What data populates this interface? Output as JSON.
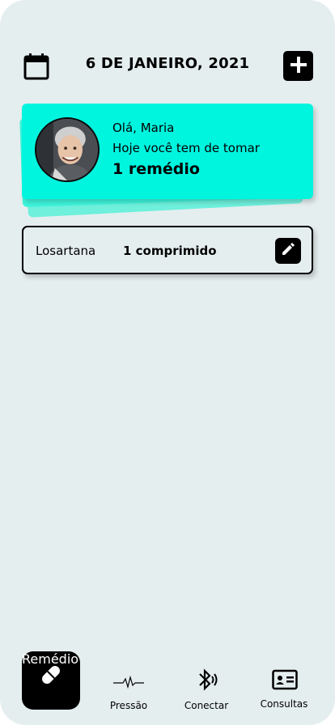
{
  "header": {
    "date": "6 DE JANEIRO, 2021",
    "calendar_icon": "calendar-icon",
    "add_icon": "plus-icon"
  },
  "summary": {
    "greeting": "Olá, Maria",
    "subtitle": "Hoje você tem de tomar",
    "count": "1 remédio",
    "accent_color": "#00f5df"
  },
  "medications": [
    {
      "name": "Losartana",
      "dose": "1 comprimido",
      "edit_icon": "pencil-icon"
    }
  ],
  "nav": {
    "items": [
      {
        "label": "Remédio",
        "icon": "pill-icon",
        "active": true
      },
      {
        "label": "Pressão",
        "icon": "heartbeat-icon",
        "active": false
      },
      {
        "label": "Conectar",
        "icon": "bluetooth-icon",
        "active": false
      },
      {
        "label": "Consultas",
        "icon": "id-card-icon",
        "active": false
      }
    ]
  },
  "colors": {
    "background": "#e5eeef",
    "dark": "#000000"
  }
}
